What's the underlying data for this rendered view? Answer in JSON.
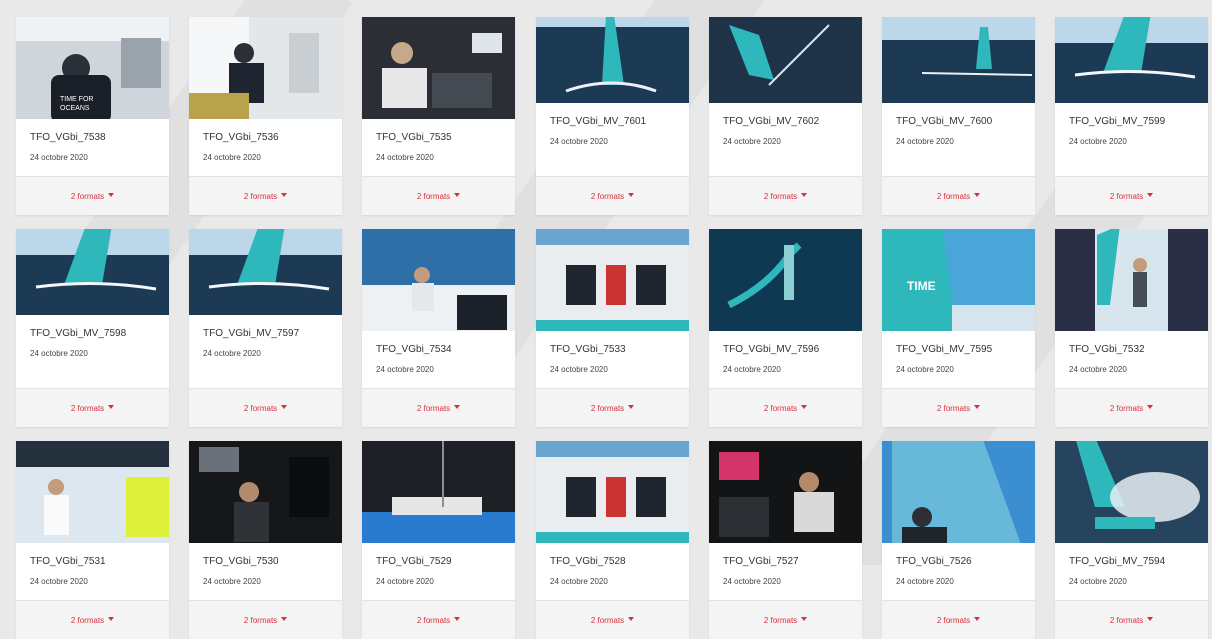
{
  "photos": [
    {
      "id": "TFO_VGbi_7538",
      "date": "24 octobre 2020",
      "formats": "2 formats",
      "scene": "cabin-dark"
    },
    {
      "id": "TFO_VGbi_7536",
      "date": "24 octobre 2020",
      "formats": "2 formats",
      "scene": "cabin-light"
    },
    {
      "id": "TFO_VGbi_7535",
      "date": "24 octobre 2020",
      "formats": "2 formats",
      "scene": "cabin-nav"
    },
    {
      "id": "TFO_VGbi_MV_7601",
      "date": "24 octobre 2020",
      "formats": "2 formats",
      "scene": "boat-sea"
    },
    {
      "id": "TFO_VGbi_MV_7602",
      "date": "24 octobre 2020",
      "formats": "2 formats",
      "scene": "boat-aerial"
    },
    {
      "id": "TFO_VGbi_MV_7600",
      "date": "24 octobre 2020",
      "formats": "2 formats",
      "scene": "boat-far"
    },
    {
      "id": "TFO_VGbi_MV_7599",
      "date": "24 octobre 2020",
      "formats": "2 formats",
      "scene": "boat-heel"
    },
    {
      "id": "TFO_VGbi_MV_7598",
      "date": "24 octobre 2020",
      "formats": "2 formats",
      "scene": "boat-heel"
    },
    {
      "id": "TFO_VGbi_MV_7597",
      "date": "24 octobre 2020",
      "formats": "2 formats",
      "scene": "boat-heel"
    },
    {
      "id": "TFO_VGbi_7534",
      "date": "24 octobre 2020",
      "formats": "2 formats",
      "scene": "deck-blue"
    },
    {
      "id": "TFO_VGbi_7533",
      "date": "24 octobre 2020",
      "formats": "2 formats",
      "scene": "deck-gear"
    },
    {
      "id": "TFO_VGbi_MV_7596",
      "date": "24 octobre 2020",
      "formats": "2 formats",
      "scene": "foil"
    },
    {
      "id": "TFO_VGbi_MV_7595",
      "date": "24 octobre 2020",
      "formats": "2 formats",
      "scene": "sail-text"
    },
    {
      "id": "TFO_VGbi_7532",
      "date": "24 octobre 2020",
      "formats": "2 formats",
      "scene": "portrait"
    },
    {
      "id": "TFO_VGbi_7531",
      "date": "24 octobre 2020",
      "formats": "2 formats",
      "scene": "deck-crew"
    },
    {
      "id": "TFO_VGbi_7530",
      "date": "24 octobre 2020",
      "formats": "2 formats",
      "scene": "cabin-night"
    },
    {
      "id": "TFO_VGbi_7529",
      "date": "24 octobre 2020",
      "formats": "2 formats",
      "scene": "bunk"
    },
    {
      "id": "TFO_VGbi_7528",
      "date": "24 octobre 2020",
      "formats": "2 formats",
      "scene": "deck-gear"
    },
    {
      "id": "TFO_VGbi_7527",
      "date": "24 octobre 2020",
      "formats": "2 formats",
      "scene": "cabin-screens"
    },
    {
      "id": "TFO_VGbi_7526",
      "date": "24 octobre 2020",
      "formats": "2 formats",
      "scene": "sail-crew"
    },
    {
      "id": "TFO_VGbi_MV_7594",
      "date": "24 octobre 2020",
      "formats": "2 formats",
      "scene": "spray"
    }
  ],
  "colors": {
    "accent": "#d9303c",
    "brand_teal": "#29b3b8"
  }
}
